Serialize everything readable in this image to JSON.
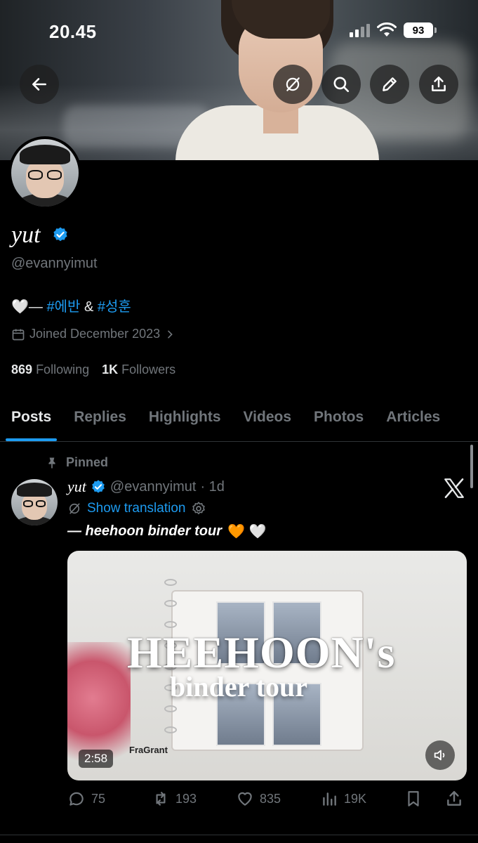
{
  "status_bar": {
    "time": "20.45",
    "battery": "93"
  },
  "profile": {
    "display_name": "yut",
    "handle": "@evannyimut",
    "bio_prefix": "🤍— ",
    "bio_tag1": "#에반",
    "bio_and": " & ",
    "bio_tag2": "#성훈",
    "joined": "Joined December 2023",
    "following_count": "869",
    "following_label": "Following",
    "followers_count": "1K",
    "followers_label": "Followers"
  },
  "tabs": [
    "Posts",
    "Replies",
    "Highlights",
    "Videos",
    "Photos",
    "Articles"
  ],
  "active_tab": "Posts",
  "pinned_tweet": {
    "pinned_label": "Pinned",
    "name": "yut",
    "handle": "@evannyimut",
    "time": "· 1d",
    "show_translation": "Show translation",
    "text": "— heehoon binder tour",
    "emoji": "🧡 🤍",
    "media": {
      "title_line1": "HEEHOON's",
      "title_line2": "binder tour",
      "brand": "FraGrant",
      "duration": "2:58"
    },
    "replies": "75",
    "reposts": "193",
    "likes": "835",
    "views": "19K"
  },
  "colors": {
    "accent": "#1d9bf0",
    "muted": "#71767b",
    "background": "#000000"
  }
}
